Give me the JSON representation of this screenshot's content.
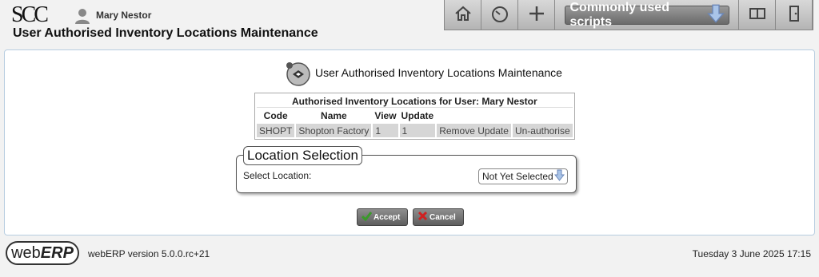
{
  "header": {
    "logo_text": "SCC",
    "user_name": "Mary Nestor",
    "page_title": "User Authorised Inventory Locations Maintenance"
  },
  "toolbar": {
    "items": [
      "home-icon",
      "dashboard-icon",
      "plus-icon",
      "scripts-dropdown",
      "manual-icon",
      "logout-icon"
    ],
    "scripts_label": "Commonly used scripts"
  },
  "main": {
    "title": "User Authorised Inventory Locations Maintenance",
    "table": {
      "title": "Authorised Inventory Locations for User: Mary Nestor",
      "headers": [
        "Code",
        "Name",
        "View",
        "Update"
      ],
      "rows": [
        {
          "code": "SHOPT",
          "name": "Shopton Factory",
          "view": "1",
          "update": "1",
          "remove_update": "Remove Update",
          "unauthorise": "Un-authorise"
        }
      ]
    },
    "location_selection": {
      "legend": "Location Selection",
      "label": "Select Location:",
      "selected": "Not Yet Selected"
    },
    "buttons": {
      "accept": "Accept",
      "cancel": "Cancel"
    }
  },
  "footer": {
    "logo_web": "web",
    "logo_erp": "ERP",
    "version": "webERP version 5.0.0.rc+21",
    "datetime": "Tuesday 3 June 2025 17:15"
  },
  "colors": {
    "toolbar_bg": "#c4c4c4",
    "button_bg": "#6e6e6e",
    "accept_check": "#3a9a2a",
    "cancel_x": "#d02020",
    "panel_border": "#b7cde0",
    "arrow_blue": "#a9c4e8"
  }
}
